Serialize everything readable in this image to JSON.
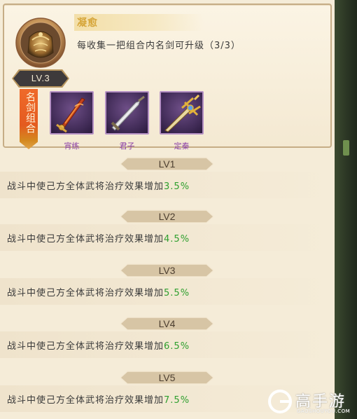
{
  "skill": {
    "name": "凝愈",
    "description": "每收集一把组合内名剑可升级（3/3）",
    "level": "LV.3",
    "icon": "bronze-armor-icon"
  },
  "combo": {
    "tag": "名剑组合",
    "swords": [
      {
        "label": "宵练",
        "icon": "flame-blade-icon"
      },
      {
        "label": "君子",
        "icon": "silver-sword-icon"
      },
      {
        "label": "定秦",
        "icon": "golden-sword-icon"
      }
    ]
  },
  "levels": [
    {
      "label": "LV1",
      "text": "战斗中使己方全体武将治疗效果增加",
      "value": "3.5%"
    },
    {
      "label": "LV2",
      "text": "战斗中使己方全体武将治疗效果增加",
      "value": "4.5%"
    },
    {
      "label": "LV3",
      "text": "战斗中使己方全体武将治疗效果增加",
      "value": "5.5%"
    },
    {
      "label": "LV4",
      "text": "战斗中使己方全体武将治疗效果增加",
      "value": "6.5%"
    },
    {
      "label": "LV5",
      "text": "战斗中使己方全体武将治疗效果增加",
      "value": "7.5%"
    }
  ],
  "watermark": {
    "brand": "高手游",
    "url": "GAOSHOUYOU.COM"
  },
  "colors": {
    "panel": "#f5ecd8",
    "highlight": "#2e9f2e",
    "skill_name": "#d6a63a",
    "sword_label": "#8a3fa7",
    "combo_tag": "#e45b1f"
  }
}
